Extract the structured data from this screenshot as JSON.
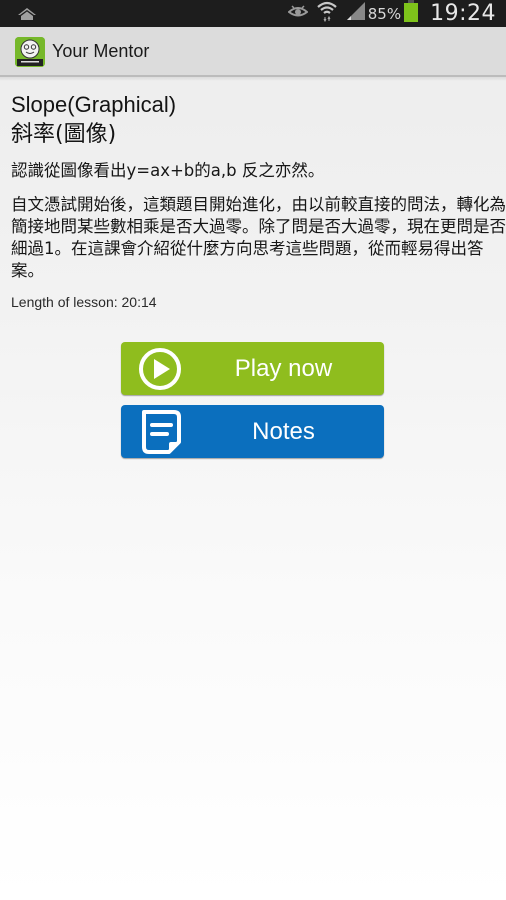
{
  "status_bar": {
    "icons": [
      "home-icon",
      "eye-icon",
      "wifi-icon",
      "signal-icon",
      "battery-icon"
    ],
    "battery_percent": "85%",
    "time": "19:24",
    "colors": {
      "battery": "#7ec31b",
      "background": "#1d1d1d"
    }
  },
  "action_bar": {
    "app_icon": "your-mentor-logo",
    "title": "Your Mentor"
  },
  "lesson": {
    "title_en": "Slope(Graphical)",
    "title_zh": "斜率(圖像)",
    "summary": "認識從圖像看出y=ax+b的a,b 反之亦然。",
    "description": "自文憑試開始後，這類題目開始進化，由以前較直接的問法，轉化為簡接地問某些數相乘是否大過零。除了問是否大過零，現在更問是否細過1。在這課會介紹從什麼方向思考這些問題，從而輕易得出答案。",
    "length_label": "Length of lesson: 20:14"
  },
  "buttons": {
    "play": {
      "label": "Play now",
      "icon": "play-circle-icon",
      "color": "#8fbd1e"
    },
    "notes": {
      "label": "Notes",
      "icon": "notes-icon",
      "color": "#0b6fbe"
    }
  }
}
